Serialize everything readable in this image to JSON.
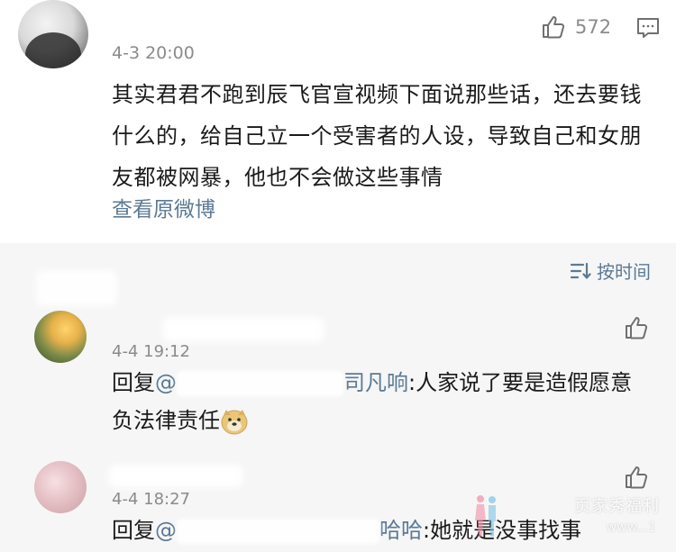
{
  "main_comment": {
    "timestamp": "4-3 20:00",
    "like_count": "572",
    "text": "其实君君不跑到辰飞官宣视频下面说那些话，还去要钱什么的，给自己立一个受害者的人设，导致自己和女朋友都被网暴，他也不会做这些事情",
    "view_original_label": "查看原微博"
  },
  "sort": {
    "label": "按时间"
  },
  "replies": [
    {
      "timestamp": "4-4 19:12",
      "prefix": "回复",
      "at_prefix": "@",
      "at_visible_suffix": "司凡响",
      "colon": ":",
      "text": "人家说了要是造假愿意负法律责任"
    },
    {
      "timestamp": "4-4 18:27",
      "prefix": "回复",
      "at_prefix": "@",
      "at_visible_suffix": "哈哈",
      "colon": ":",
      "text": "她就是没事找事"
    }
  ],
  "watermark": {
    "text": "页家秀福利",
    "url": "www...1"
  },
  "colors": {
    "link": "#5b7a95",
    "meta": "#8b8b8b",
    "text": "#1a1a1a",
    "background": "#f6f6f6",
    "card": "#ffffff"
  },
  "icons": [
    "like-icon",
    "comment-icon",
    "sort-icon",
    "doge-emoji"
  ]
}
